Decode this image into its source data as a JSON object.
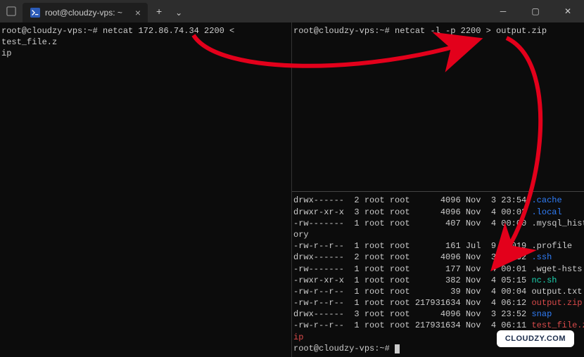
{
  "titlebar": {
    "tab_title": "root@cloudzy-vps: ~",
    "tab_close": "×",
    "newtab": "+",
    "chev": "⌄",
    "min": "─",
    "max": "▢",
    "close": "✕"
  },
  "left": {
    "prompt": "root@cloudzy-vps:~#",
    "command": "netcat 172.86.74.34 2200 < test_file.z",
    "wrap": "ip"
  },
  "right_top": {
    "prompt": "root@cloudzy-vps:~#",
    "command": "netcat -l -p 2200 > output.zip"
  },
  "ls": {
    "rows": [
      {
        "perm": "drwx------",
        "n": "2",
        "o": "root",
        "g": "root",
        "size": "4096",
        "m": "Nov",
        "d": "3",
        "t": "23:54",
        "name": ".cache",
        "cls": "fn-blue"
      },
      {
        "perm": "drwxr-xr-x",
        "n": "3",
        "o": "root",
        "g": "root",
        "size": "4096",
        "m": "Nov",
        "d": "4",
        "t": "00:02",
        "name": ".local",
        "cls": "fn-blue"
      },
      {
        "perm": "-rw-------",
        "n": "1",
        "o": "root",
        "g": "root",
        "size": "407",
        "m": "Nov",
        "d": "4",
        "t": "00:00",
        "name": ".mysql_hist",
        "cls": ""
      }
    ],
    "wrap1": "ory",
    "rows2": [
      {
        "perm": "-rw-r--r--",
        "n": "1",
        "o": "root",
        "g": "root",
        "size": "161",
        "m": "Jul",
        "d": "9",
        "t": " 2019",
        "name": ".profile",
        "cls": ""
      },
      {
        "perm": "drwx------",
        "n": "2",
        "o": "root",
        "g": "root",
        "size": "4096",
        "m": "Nov",
        "d": "3",
        "t": "23:52",
        "name": ".ssh",
        "cls": "fn-blue"
      },
      {
        "perm": "-rw-------",
        "n": "1",
        "o": "root",
        "g": "root",
        "size": "177",
        "m": "Nov",
        "d": "4",
        "t": "00:01",
        "name": ".wget-hsts",
        "cls": ""
      },
      {
        "perm": "-rwxr-xr-x",
        "n": "1",
        "o": "root",
        "g": "root",
        "size": "382",
        "m": "Nov",
        "d": "4",
        "t": "05:15",
        "name": "nc.sh",
        "cls": "fn-cyan"
      },
      {
        "perm": "-rw-r--r--",
        "n": "1",
        "o": "root",
        "g": "root",
        "size": "39",
        "m": "Nov",
        "d": "4",
        "t": "00:04",
        "name": "output.txt",
        "cls": ""
      },
      {
        "perm": "-rw-r--r--",
        "n": "1",
        "o": "root",
        "g": "root",
        "size": "217931634",
        "m": "Nov",
        "d": "4",
        "t": "06:12",
        "name": "output.zip",
        "cls": "fn-red"
      },
      {
        "perm": "drwx------",
        "n": "3",
        "o": "root",
        "g": "root",
        "size": "4096",
        "m": "Nov",
        "d": "3",
        "t": "23:52",
        "name": "snap",
        "cls": "fn-blue"
      },
      {
        "perm": "-rw-r--r--",
        "n": "1",
        "o": "root",
        "g": "root",
        "size": "217931634",
        "m": "Nov",
        "d": "4",
        "t": "06:11",
        "name": "test_file.z",
        "cls": "fn-red"
      }
    ],
    "wrap2": "ip",
    "final_prompt": "root@cloudzy-vps:~#"
  },
  "badge": "CLOUDZY.COM"
}
